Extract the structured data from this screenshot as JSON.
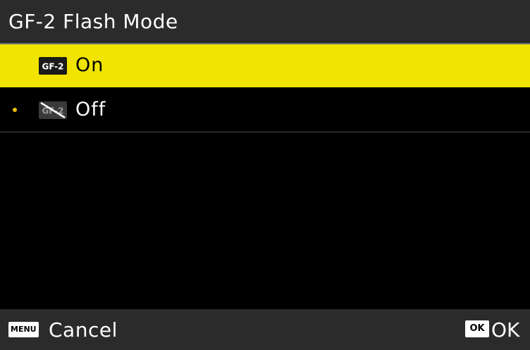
{
  "header": {
    "title": "GF-2 Flash Mode"
  },
  "options": [
    {
      "label": "On",
      "icon": "gf2-flash-on-icon",
      "icon_text": "GF-2",
      "selected": true,
      "current": false
    },
    {
      "label": "Off",
      "icon": "gf2-flash-off-icon",
      "icon_text": "GF-2",
      "selected": false,
      "current": true
    }
  ],
  "footer": {
    "menu_key": "MENU",
    "cancel_label": "Cancel",
    "ok_key": "OK",
    "ok_label": "OK"
  },
  "colors": {
    "highlight": "#f0e400",
    "background": "#000000",
    "bar": "#2b2b2b",
    "current_dot": "#e8c400"
  }
}
